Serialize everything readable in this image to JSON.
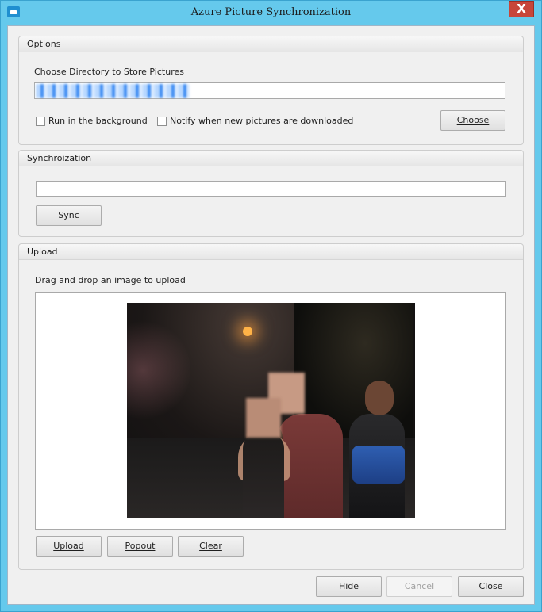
{
  "window": {
    "title": "Azure Picture Synchronization",
    "close_glyph": "X"
  },
  "options": {
    "header": "Options",
    "directory_label": "Choose Directory to Store Pictures",
    "directory_value": "",
    "run_background_label": "Run in the background",
    "notify_label": "Notify when new pictures are downloaded",
    "run_background_checked": false,
    "notify_checked": false,
    "choose_button": "Choose"
  },
  "sync": {
    "header": "Synchroization",
    "status_value": "",
    "sync_button": "Sync"
  },
  "upload": {
    "header": "Upload",
    "hint": "Drag and drop an image to upload",
    "upload_button": "Upload",
    "popout_button": "Popout",
    "clear_button": "Clear"
  },
  "footer": {
    "hide_button": "Hide",
    "cancel_button": "Cancel",
    "close_button": "Close"
  },
  "colors": {
    "titlebar": "#65c9ec",
    "close_button": "#c7463a",
    "client_background": "#f0f0f0"
  },
  "icons": [
    "app-cloud-icon",
    "close-icon"
  ]
}
